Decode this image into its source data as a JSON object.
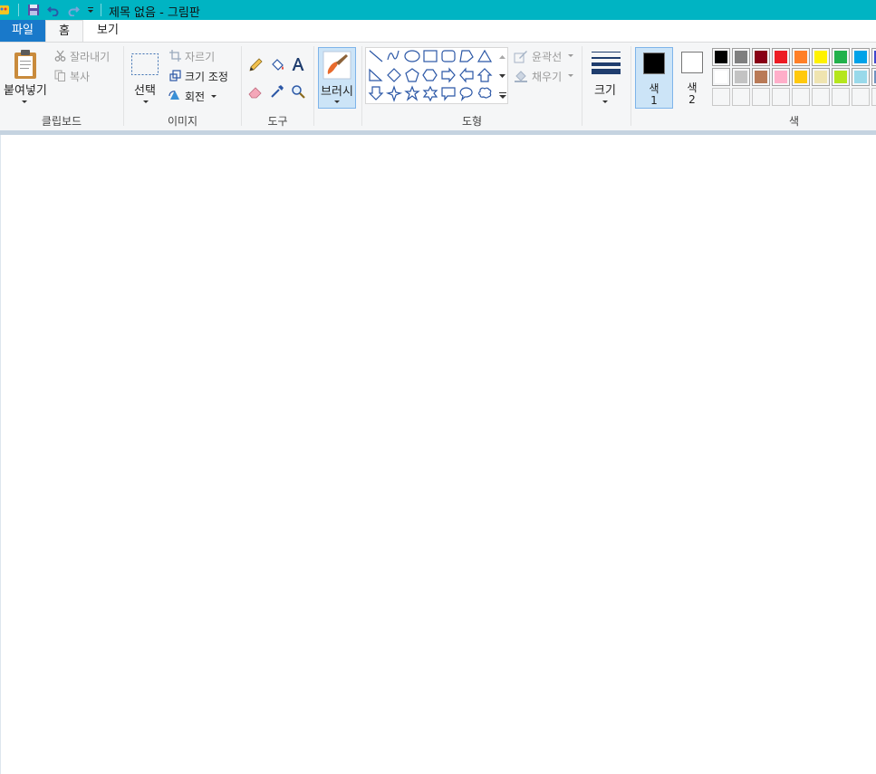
{
  "window": {
    "title": "제목 없음 - 그림판"
  },
  "menu": {
    "file": "파일",
    "home": "홈",
    "view": "보기"
  },
  "clipboard": {
    "paste": "붙여넣기",
    "cut": "잘라내기",
    "copy": "복사",
    "label": "클립보드"
  },
  "image": {
    "select": "선택",
    "crop": "자르기",
    "resize": "크기 조정",
    "rotate": "회전",
    "label": "이미지"
  },
  "tools": {
    "label": "도구"
  },
  "brush": {
    "label": "브러시"
  },
  "shapes": {
    "outline": "윤곽선",
    "fill": "채우기",
    "label": "도형"
  },
  "size": {
    "label": "크기"
  },
  "colors": {
    "color1_char": "색",
    "color1_num": "1",
    "color2_char": "색",
    "color2_num": "2",
    "label": "색",
    "color1": "#000000",
    "color2": "#ffffff",
    "palette": [
      [
        "#000000",
        "#7f7f7f",
        "#880015",
        "#ed1c24",
        "#ff7f27",
        "#fff200",
        "#22b14c",
        "#00a2e8",
        "#3f48cc"
      ],
      [
        "#ffffff",
        "#c3c3c3",
        "#b97a57",
        "#ffaec9",
        "#ffc90e",
        "#efe4b0",
        "#b5e61d",
        "#99d9ea",
        "#7092be"
      ],
      [
        "",
        "",
        "",
        "",
        "",
        "",
        "",
        "",
        ""
      ]
    ]
  }
}
